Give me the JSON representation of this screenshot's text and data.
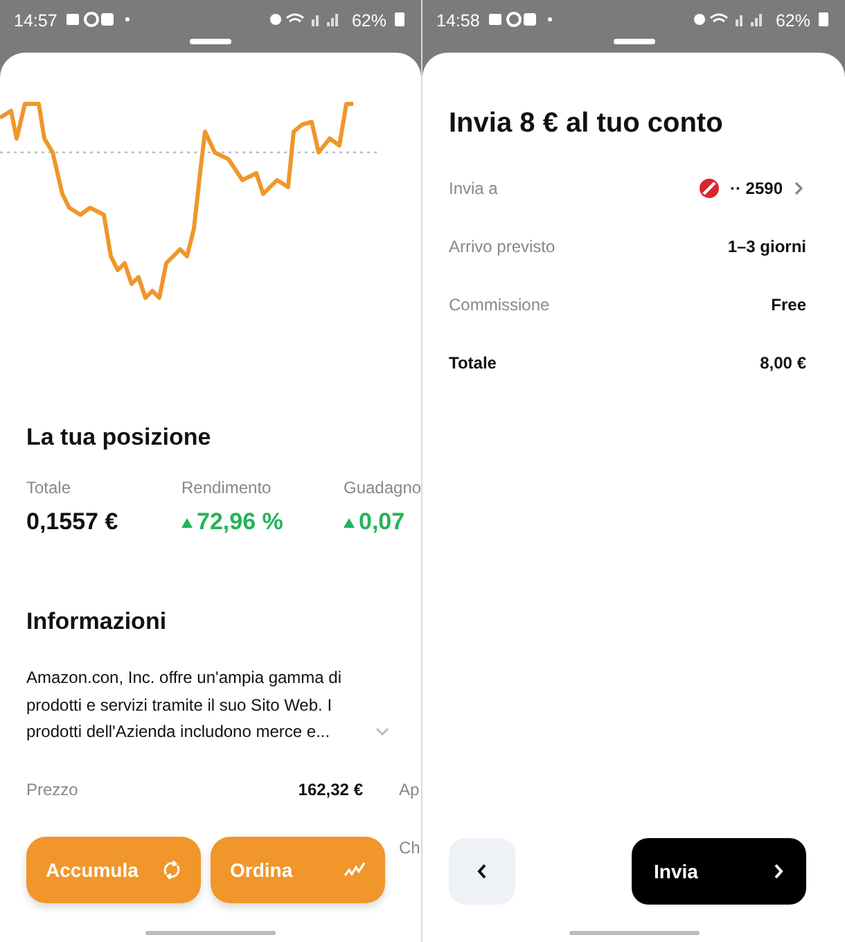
{
  "portfolio_screen": {
    "status_bar": {
      "time": "14:57",
      "battery": "62%"
    },
    "position": {
      "title": "La tua posizione",
      "stats": [
        {
          "label": "Totale",
          "value": "0,1557 €",
          "kind": "amount"
        },
        {
          "label": "Rendimento",
          "value": "72,96 %",
          "kind": "gain"
        },
        {
          "label": "Guadagno",
          "value": "0,07",
          "kind": "gain"
        }
      ]
    },
    "info": {
      "title": "Informazioni",
      "description": "Amazon.con, Inc. offre un'ampia gamma di prodotti e servizi tramite il suo Sito Web. I prodotti dell'Azienda includono merce e...",
      "expanded": false,
      "rows": [
        {
          "label": "Prezzo",
          "value": "162,32 €",
          "column_3": "Ap"
        },
        {
          "column_3": "Ch"
        }
      ]
    },
    "actions": [
      {
        "label": "Accumula",
        "kind": "recurring"
      },
      {
        "label": "Ordina",
        "kind": "order"
      }
    ]
  },
  "transfer_screen": {
    "status_bar": {
      "time": "14:58",
      "battery": "62%"
    },
    "title": "Invia 8 € al tuo conto",
    "rows": [
      {
        "label": "Invia a",
        "value": "·· 2590",
        "kind": "account"
      },
      {
        "label": "Arrivo previsto",
        "value": "1–3 giorni",
        "kind": "detail"
      },
      {
        "label": "Commissione",
        "value": "Free",
        "kind": "detail"
      },
      {
        "label": "Totale",
        "value": "8,00 €",
        "kind": "total"
      }
    ],
    "submit": {
      "label": "Invia"
    }
  }
}
